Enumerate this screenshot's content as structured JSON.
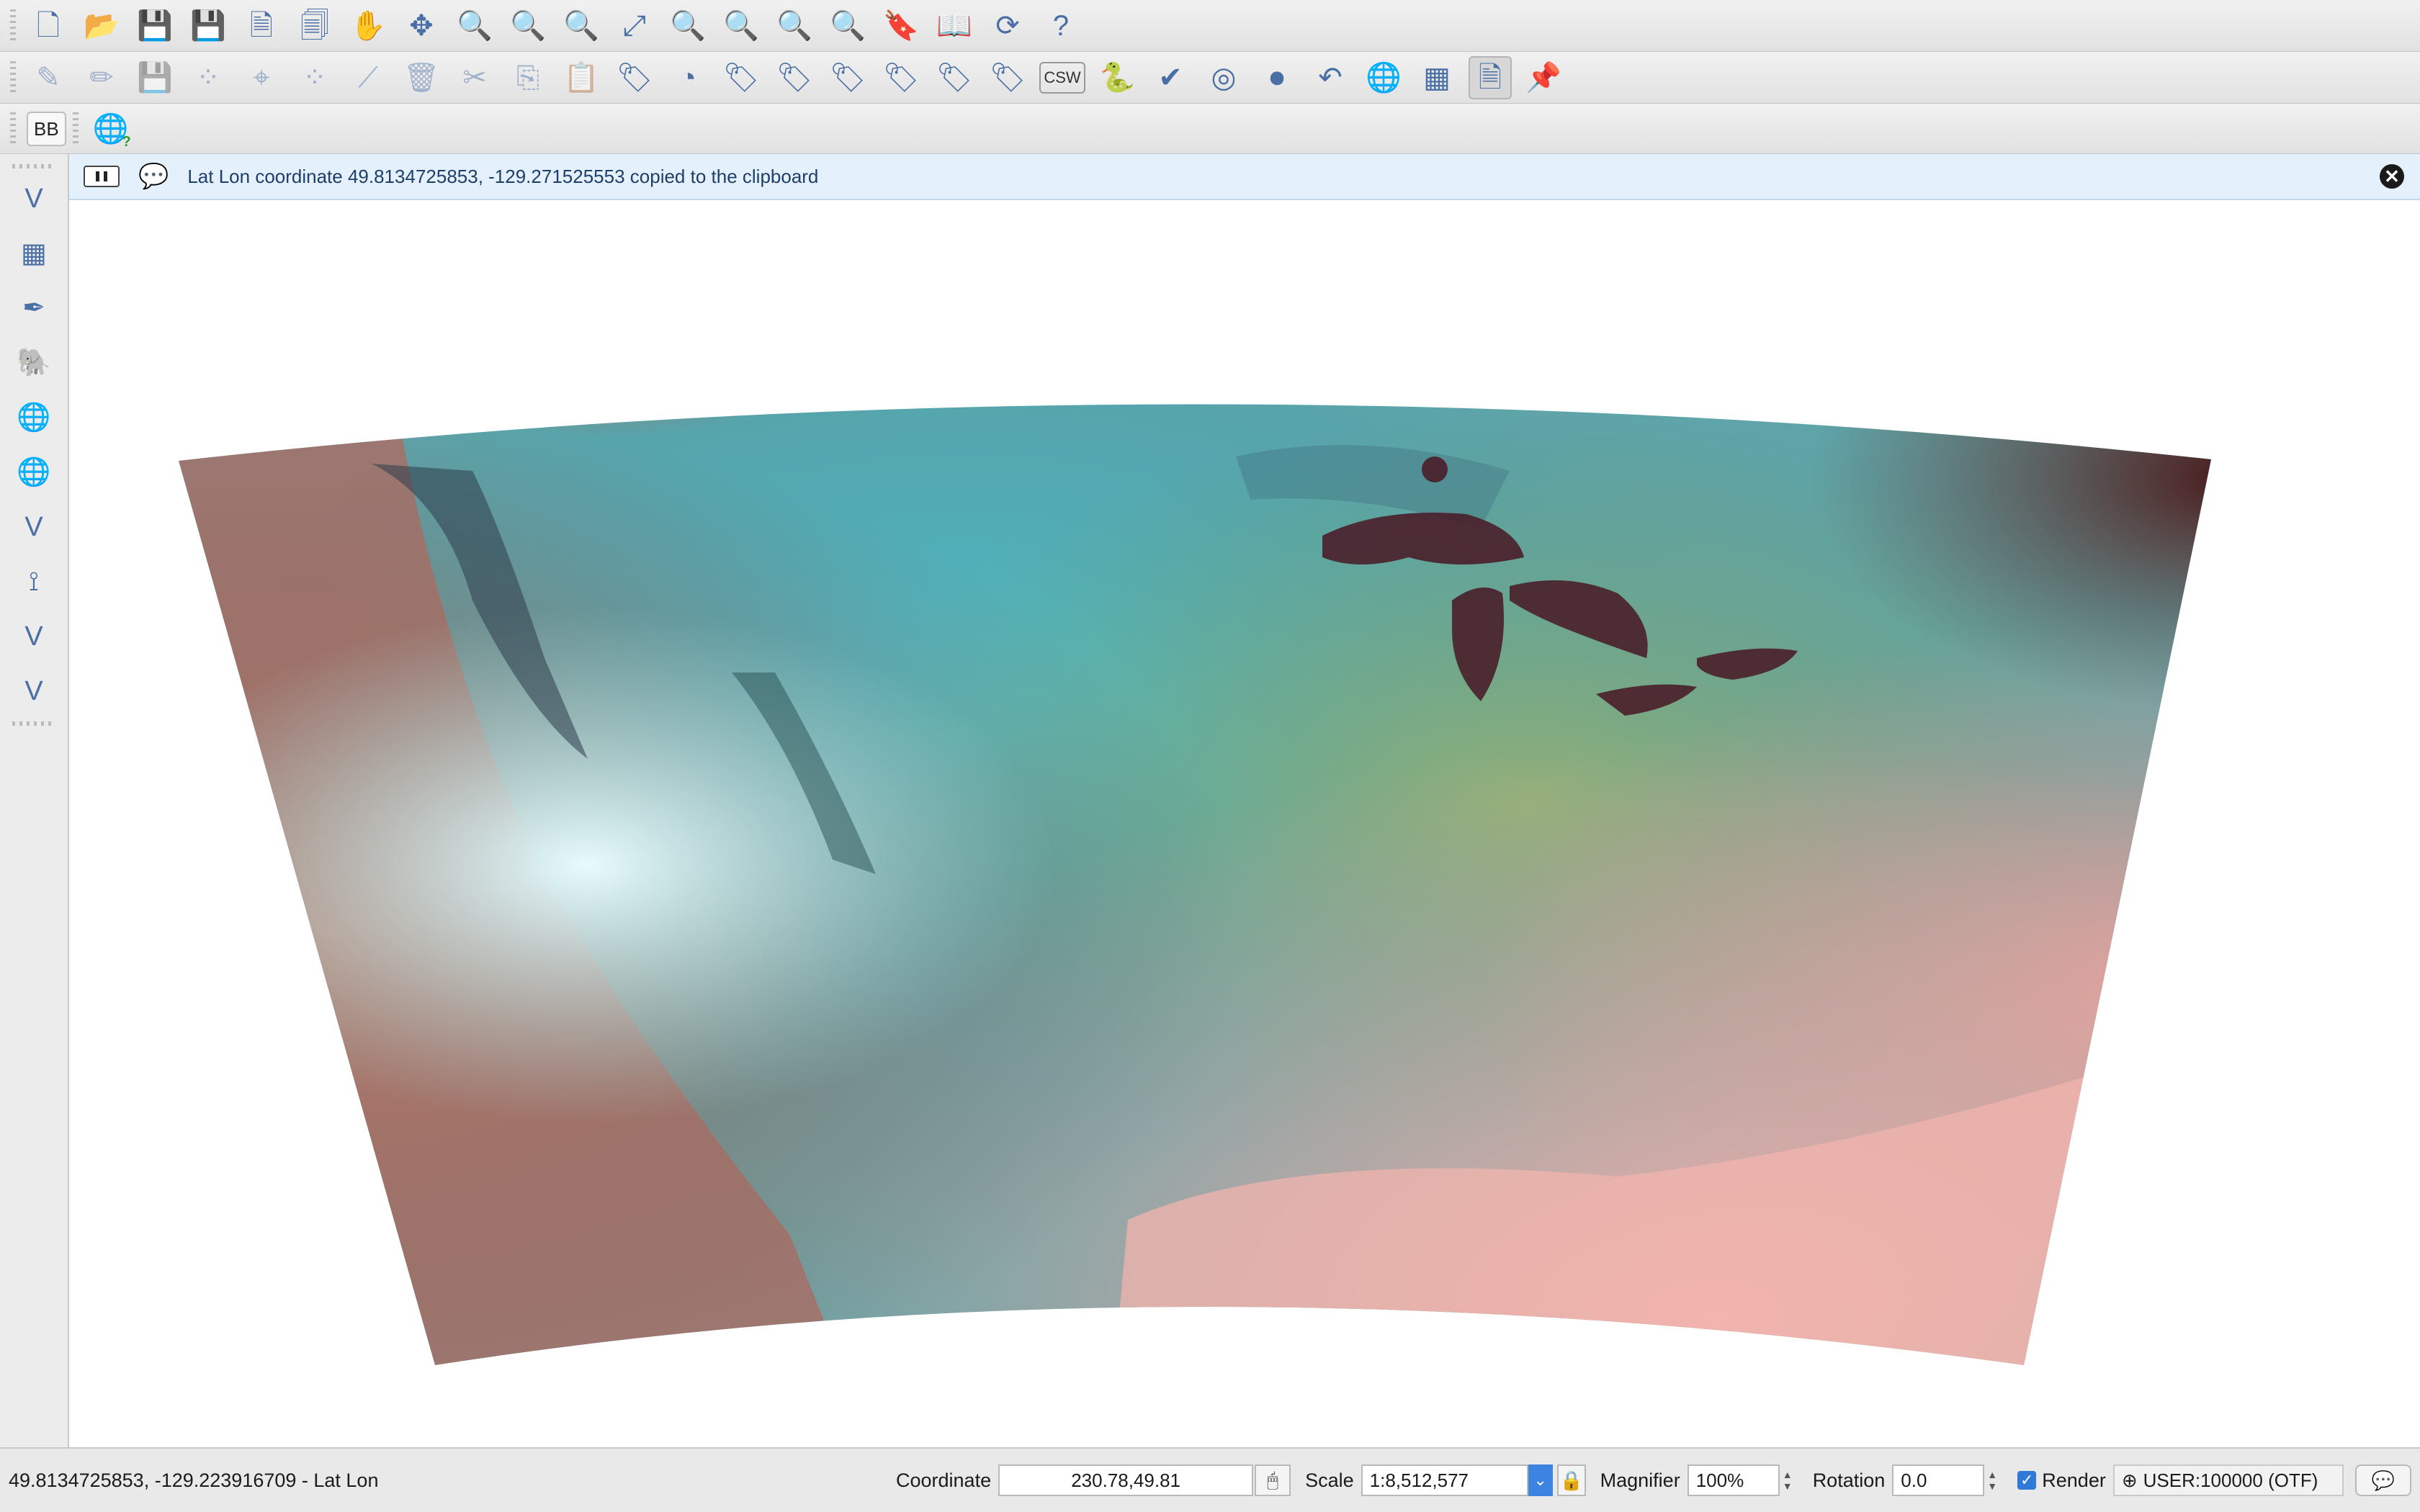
{
  "toolbars": {
    "row1": [
      {
        "name": "new-project-icon",
        "glyph": "🗋"
      },
      {
        "name": "open-project-icon",
        "glyph": "📂"
      },
      {
        "name": "save-project-icon",
        "glyph": "💾"
      },
      {
        "name": "save-as-icon",
        "glyph": "💾"
      },
      {
        "name": "new-print-composer-icon",
        "glyph": "🗎"
      },
      {
        "name": "composer-manager-icon",
        "glyph": "🗐"
      },
      {
        "name": "pan-map-icon",
        "glyph": "✋"
      },
      {
        "name": "pan-to-selection-icon",
        "glyph": "✥"
      },
      {
        "name": "zoom-in-icon",
        "glyph": "🔍"
      },
      {
        "name": "zoom-out-icon",
        "glyph": "🔍"
      },
      {
        "name": "zoom-native-resolution-icon",
        "glyph": "🔍"
      },
      {
        "name": "zoom-full-icon",
        "glyph": "⤢"
      },
      {
        "name": "zoom-to-selection-icon",
        "glyph": "🔍"
      },
      {
        "name": "zoom-to-layer-icon",
        "glyph": "🔍"
      },
      {
        "name": "zoom-last-icon",
        "glyph": "🔍"
      },
      {
        "name": "zoom-next-icon",
        "glyph": "🔍"
      },
      {
        "name": "new-bookmark-icon",
        "glyph": "🔖"
      },
      {
        "name": "show-bookmarks-icon",
        "glyph": "📖"
      },
      {
        "name": "refresh-icon",
        "glyph": "⟳"
      },
      {
        "name": "help-icon",
        "glyph": "?"
      }
    ],
    "row2": [
      {
        "name": "current-edits-icon",
        "glyph": "✎",
        "dim": true
      },
      {
        "name": "toggle-editing-icon",
        "glyph": "✏",
        "dim": true
      },
      {
        "name": "save-layer-edits-icon",
        "glyph": "💾",
        "dim": true
      },
      {
        "name": "add-feature-icon",
        "glyph": "⁘",
        "dim": true
      },
      {
        "name": "move-feature-icon",
        "glyph": "⌖",
        "dim": true
      },
      {
        "name": "node-tool-icon",
        "glyph": "⁘",
        "dim": true
      },
      {
        "name": "node-edit-icon",
        "glyph": "⟋",
        "dim": true
      },
      {
        "name": "delete-selected-icon",
        "glyph": "🗑",
        "dim": true
      },
      {
        "name": "cut-features-icon",
        "glyph": "✂",
        "dim": true
      },
      {
        "name": "copy-features-icon",
        "glyph": "⎘",
        "dim": true
      },
      {
        "name": "paste-features-icon",
        "glyph": "📋",
        "dim": true
      },
      {
        "name": "layer-labeling-icon",
        "glyph": "🏷"
      },
      {
        "name": "layer-diagram-icon",
        "glyph": "◔"
      },
      {
        "name": "pin-labels-icon",
        "glyph": "🏷"
      },
      {
        "name": "highlight-pinned-labels-icon",
        "glyph": "🏷"
      },
      {
        "name": "show-hide-labels-icon",
        "glyph": "🏷"
      },
      {
        "name": "move-label-icon",
        "glyph": "🏷"
      },
      {
        "name": "rotate-label-icon",
        "glyph": "🏷"
      },
      {
        "name": "change-label-icon",
        "glyph": "🏷"
      },
      {
        "name": "csw-icon",
        "glyph": "CSW"
      },
      {
        "name": "python-console-icon",
        "glyph": "🐍"
      },
      {
        "name": "validate-icon",
        "glyph": "✔"
      },
      {
        "name": "target-icon",
        "glyph": "◎"
      },
      {
        "name": "record-icon",
        "glyph": "⏺"
      },
      {
        "name": "undo-icon",
        "glyph": "↶"
      },
      {
        "name": "globe-icon",
        "glyph": "🌐"
      },
      {
        "name": "grid-plugin-icon",
        "glyph": "▦"
      },
      {
        "name": "print-layout-icon",
        "glyph": "🗎",
        "pressed": true
      },
      {
        "name": "pin-map-icon",
        "glyph": "📌"
      }
    ],
    "row3_bb_label": "BB"
  },
  "left_toolbar": [
    {
      "name": "add-vector-layer-icon",
      "glyph": "V"
    },
    {
      "name": "add-raster-layer-icon",
      "glyph": "▦"
    },
    {
      "name": "add-delimited-text-icon",
      "glyph": "✒"
    },
    {
      "name": "add-postgis-layer-icon",
      "glyph": "🐘"
    },
    {
      "name": "add-wms-layer-icon",
      "glyph": "🌐"
    },
    {
      "name": "add-wcs-layer-icon",
      "glyph": "🌐"
    },
    {
      "name": "add-wfs-layer-icon",
      "glyph": "V"
    },
    {
      "name": "add-gpx-layer-icon",
      "glyph": "⟟"
    },
    {
      "name": "add-virtual-layer-icon",
      "glyph": "V"
    },
    {
      "name": "new-shapefile-layer-icon",
      "glyph": "V"
    }
  ],
  "message_bar": {
    "text": "Lat Lon coordinate 49.8134725853, -129.271525553 copied to the clipboard"
  },
  "status_bar": {
    "readout": "49.8134725853, -129.223916709 - Lat Lon",
    "coordinate_label": "Coordinate",
    "coordinate_value": "230.78,49.81",
    "scale_label": "Scale",
    "scale_value": "1:8,512,577",
    "magnifier_label": "Magnifier",
    "magnifier_value": "100%",
    "rotation_label": "Rotation",
    "rotation_value": "0.0",
    "render_label": "Render",
    "crs_label": "USER:100000 (OTF)"
  },
  "colors": {
    "accent": "#3d83e0",
    "message_bg": "#e4f0fb",
    "message_text": "#1f3f6b"
  }
}
